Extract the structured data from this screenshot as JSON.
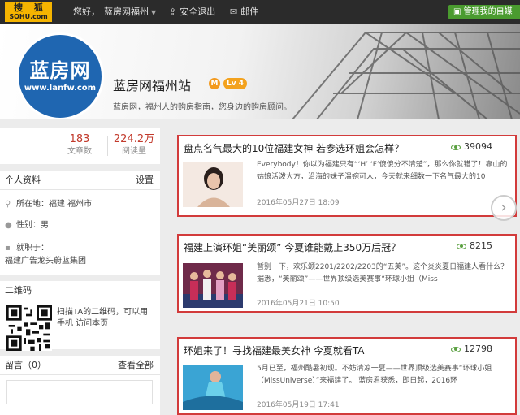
{
  "topbar": {
    "logo_top": "搜 狐",
    "logo_bottom": "SOHU.com",
    "greeting": "您好，",
    "site_menu": "蓝房网福州",
    "logout": "安全退出",
    "mail": "邮件",
    "manage": "管理我的自媒"
  },
  "banner": {
    "avatar_name": "蓝房网",
    "avatar_url": "www.lanfw.com",
    "site_title": "蓝房网福州站",
    "badge_m": "M",
    "level": "Lv 4",
    "description": "蓝房网，福州人的购房指南，您身边的购房顾问。"
  },
  "stats": {
    "articles_count": "183",
    "articles_label": "文章数",
    "reads_count": "224.2万",
    "reads_label": "阅读量"
  },
  "profile": {
    "header": "个人资料",
    "settings": "设置",
    "location_label": "所在地：福建 福州市",
    "gender_label": "性别：男",
    "job_label": "就职于：",
    "job_value": "福建广告龙头蔚蓝集团"
  },
  "qrcode": {
    "header": "二维码",
    "text": "扫描TA的二维码，可以用手机 访问本页"
  },
  "comments": {
    "header": "留言（0）",
    "view_all": "查看全部"
  },
  "articles": [
    {
      "title": "盘点名气最大的10位福建女神 若参选环姐会怎样？",
      "views": "39094",
      "excerpt": "Everybody！你以为福建只有“‘H’ ‘F’傻傻分不清楚”，那么你就错了！靠山的姑娘活泼大方，沿海的妹子温婉可人，今天就来细数一下名气最大的10",
      "date": "2016年05月27日 18:09"
    },
    {
      "title": "福建上演环姐“美丽颂” 今夏谁能戴上350万后冠？",
      "views": "8215",
      "excerpt": "暂别一下，欢乐颂2201/2202/2203的“五美”。这个炎炎夏日福建人看什么？据悉，“美丽颂”——世界顶级选美赛事“环球小姐（Miss",
      "date": "2016年05月21日 10:50"
    },
    {
      "title": "环姐来了！寻找福建最美女神 今夏就看TA",
      "views": "12798",
      "excerpt": "5月已至，福州酷暑初现。不妨清凉一夏——世界顶级选美赛事“环球小姐（MissUniverse）”来福建了。 蓝房君获悉，即日起，2016环",
      "date": "2016年05月19日 17:41"
    }
  ],
  "colors": {
    "topbar_bg": "#2b2b2b",
    "logo_bg": "#f5b400",
    "accent_red": "#d23b3b",
    "avatar_blue": "#1f66b1",
    "manage_green": "#4a9b2f"
  }
}
